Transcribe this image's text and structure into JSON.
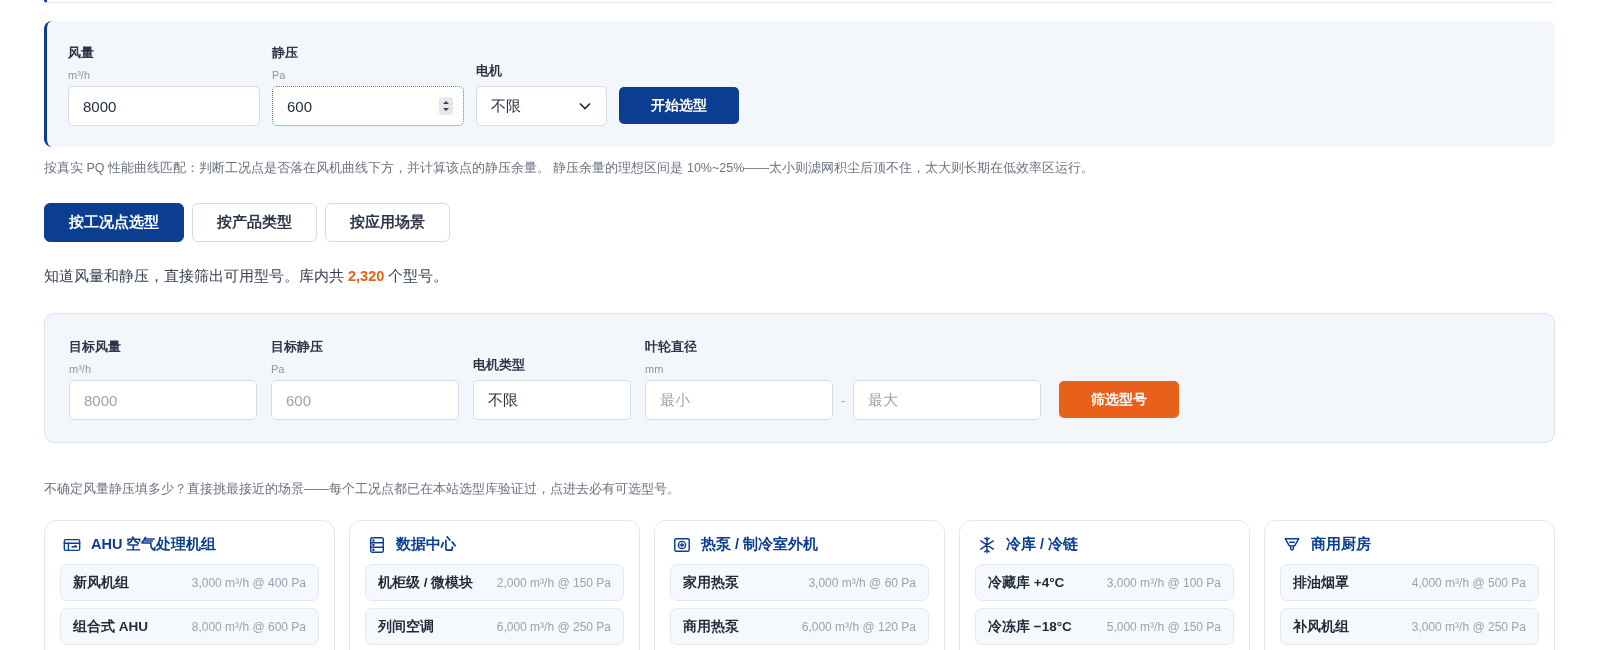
{
  "selector": {
    "fields": [
      {
        "kind": "input",
        "label": "风量",
        "unit": "m³/h",
        "value": "8000",
        "focused": false
      },
      {
        "kind": "input",
        "label": "静压",
        "unit": "Pa",
        "value": "600",
        "focused": true
      },
      {
        "kind": "select",
        "label": "电机",
        "value": "不限"
      }
    ],
    "button": "开始选型"
  },
  "note": "按真实 PQ 性能曲线匹配：判断工况点是否落在风机曲线下方，并计算该点的静压余量。 静压余量的理想区间是 10%~25%——太小则滤网积尘后顶不住，太大则长期在低效率区运行。",
  "tabs": [
    {
      "label": "按工况点选型",
      "selected": true
    },
    {
      "label": "按产品类型",
      "selected": false
    },
    {
      "label": "按应用场景",
      "selected": false
    }
  ],
  "summary": "知道风量和静压，直接筛出可用型号。库内共 **2,320** 个型号。",
  "filter": {
    "fields": [
      {
        "kind": "input",
        "label": "目标风量",
        "unit": "m³/h",
        "placeholder": "8000"
      },
      {
        "kind": "input",
        "label": "目标静压",
        "unit": "Pa",
        "placeholder": "600"
      },
      {
        "kind": "select",
        "label": "电机类型",
        "value": "不限"
      },
      {
        "kind": "range",
        "label": "叶轮直径",
        "unit": "mm",
        "placeholders": [
          "最小",
          "最大"
        ],
        "separator": "-"
      }
    ],
    "button": "筛选型号"
  },
  "scenario_note": "不确定风量静压填多少？直接挑最接近的场景——每个工况点都已在本站选型库验证过，点进去必有可选型号。",
  "scenarios": [
    {
      "kind": "ahu",
      "title": "AHU 空气处理机组",
      "items": [
        {
          "name": "新风机组",
          "spec": "3,000 m³/h @ 400 Pa"
        },
        {
          "name": "组合式 AHU",
          "spec": "8,000 m³/h @ 600 Pa"
        }
      ]
    },
    {
      "kind": "server",
      "title": "数据中心",
      "items": [
        {
          "name": "机柜级 / 微模块",
          "spec": "2,000 m³/h @ 150 Pa"
        },
        {
          "name": "列间空调",
          "spec": "6,000 m³/h @ 250 Pa"
        }
      ]
    },
    {
      "kind": "fan",
      "title": "热泵 / 制冷室外机",
      "items": [
        {
          "name": "家用热泵",
          "spec": "3,000 m³/h @ 60 Pa"
        },
        {
          "name": "商用热泵",
          "spec": "6,000 m³/h @ 120 Pa"
        }
      ]
    },
    {
      "kind": "snowflake",
      "title": "冷库 / 冷链",
      "items": [
        {
          "name": "冷藏库 +4°C",
          "spec": "3,000 m³/h @ 100 Pa"
        },
        {
          "name": "冷冻库 −18°C",
          "spec": "5,000 m³/h @ 150 Pa"
        }
      ]
    },
    {
      "kind": "hood",
      "title": "商用厨房",
      "items": [
        {
          "name": "排油烟罩",
          "spec": "4,000 m³/h @ 500 Pa"
        },
        {
          "name": "补风机组",
          "spec": "3,000 m³/h @ 250 Pa"
        }
      ]
    }
  ]
}
